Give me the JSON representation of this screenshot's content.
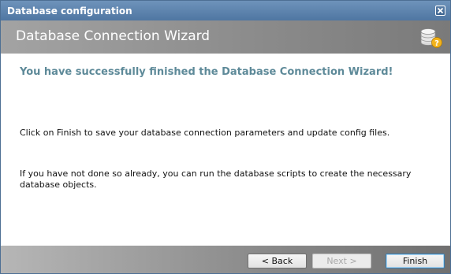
{
  "window": {
    "title": "Database configuration"
  },
  "header": {
    "wizard_title": "Database Connection Wizard",
    "icon": "database-help-icon"
  },
  "content": {
    "headline": "You have successfully finished the Database Connection Wizard!",
    "paragraph1": "Click on Finish to save your database connection parameters and update config files.",
    "paragraph2": "If you have not done so already, you can run the database scripts to create the necessary database objects."
  },
  "footer": {
    "back_label": "< Back",
    "next_label": "Next >",
    "finish_label": "Finish",
    "next_enabled": false
  },
  "colors": {
    "titlebar": "#5a80aa",
    "headline": "#5e8a99",
    "header_band": "#909090"
  }
}
